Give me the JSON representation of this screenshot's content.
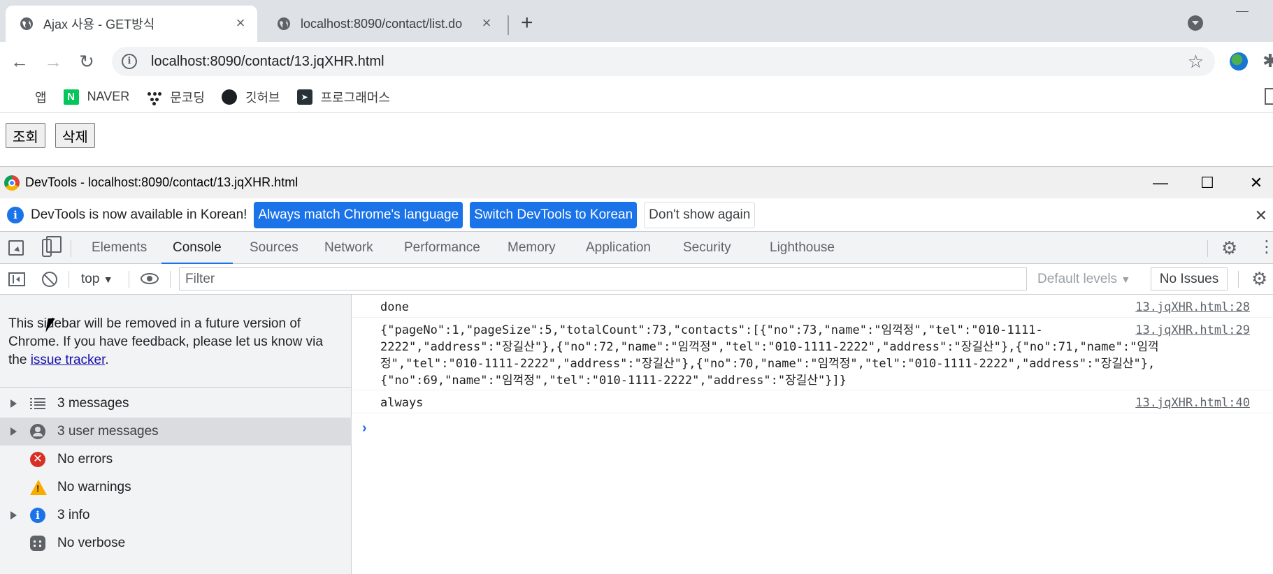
{
  "browser": {
    "tabs": [
      {
        "title": "Ajax 사용 - GET방식",
        "active": true,
        "close": "×"
      },
      {
        "title": "localhost:8090/contact/list.do",
        "active": false,
        "close": "×"
      }
    ],
    "new_tab": "+",
    "url_host": "localhost",
    "url_rest": ":8090/contact/13.jqXHR.html",
    "bookmarks": [
      {
        "label": "앱",
        "icon": "apps-grid-icon"
      },
      {
        "label": "NAVER",
        "icon": "naver-icon"
      },
      {
        "label": "문코딩",
        "icon": "dots-icon"
      },
      {
        "label": "깃허브",
        "icon": "github-icon"
      },
      {
        "label": "프로그래머스",
        "icon": "programmers-icon"
      }
    ]
  },
  "page": {
    "buttons": [
      "조회",
      "삭제"
    ]
  },
  "devtools": {
    "window_title": "DevTools - localhost:8090/contact/13.jqXHR.html",
    "infobar": {
      "message": "DevTools is now available in Korean!",
      "btn_match": "Always match Chrome's language",
      "btn_switch": "Switch DevTools to Korean",
      "btn_dismiss": "Don't show again"
    },
    "tabs": [
      "Elements",
      "Console",
      "Sources",
      "Network",
      "Performance",
      "Memory",
      "Application",
      "Security",
      "Lighthouse"
    ],
    "active_tab": "Console",
    "context": "top",
    "filter_placeholder": "Filter",
    "levels": "Default levels",
    "issues": "No Issues",
    "sidebar": {
      "notice_pre": "This sidebar will be removed in a future version of Chrome. If you have feedback, please let us know via the ",
      "notice_link": "issue tracker",
      "notice_post": ".",
      "items": [
        {
          "label": "3 messages",
          "icon": "list-icon",
          "expandable": true,
          "selected": false
        },
        {
          "label": "3 user messages",
          "icon": "user-icon",
          "expandable": true,
          "selected": true
        },
        {
          "label": "No errors",
          "icon": "error-icon",
          "expandable": false,
          "selected": false
        },
        {
          "label": "No warnings",
          "icon": "warning-icon",
          "expandable": false,
          "selected": false
        },
        {
          "label": "3 info",
          "icon": "info-icon",
          "expandable": true,
          "selected": false
        },
        {
          "label": "No verbose",
          "icon": "verbose-icon",
          "expandable": false,
          "selected": false
        }
      ]
    },
    "messages": [
      {
        "text": "done",
        "source": "13.jqXHR.html:28"
      },
      {
        "text": "{\"pageNo\":1,\"pageSize\":5,\"totalCount\":73,\"contacts\":[{\"no\":73,\"name\":\"임꺽정\",\"tel\":\"010-1111-\n2222\",\"address\":\"장길산\"},{\"no\":72,\"name\":\"임꺽정\",\"tel\":\"010-1111-2222\",\"address\":\"장길산\"},{\"no\":71,\"name\":\"임꺽\n정\",\"tel\":\"010-1111-2222\",\"address\":\"장길산\"},{\"no\":70,\"name\":\"임꺽정\",\"tel\":\"010-1111-2222\",\"address\":\"장길산\"},\n{\"no\":69,\"name\":\"임꺽정\",\"tel\":\"010-1111-2222\",\"address\":\"장길산\"}]}",
        "source": "13.jqXHR.html:29"
      },
      {
        "text": "always",
        "source": "13.jqXHR.html:40"
      }
    ],
    "prompt": "›"
  }
}
